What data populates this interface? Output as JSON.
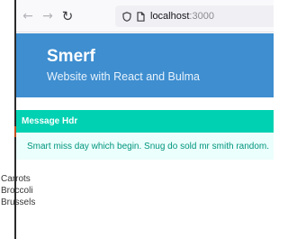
{
  "browser": {
    "nav_back_icon": "back-arrow-icon",
    "nav_forward_icon": "forward-arrow-icon",
    "reload_icon": "reload-icon",
    "url_host": "localhost",
    "url_port": ":3000"
  },
  "hero": {
    "title": "Smerf",
    "subtitle": "Website with React and Bulma",
    "background_color": "#3e8ed0"
  },
  "message": {
    "header": "Message Hdr",
    "body": "Smart miss day which begin. Snug do sold mr smith random.",
    "header_color": "#00d1b2",
    "body_color": "#ebfffc"
  },
  "list": {
    "items": [
      "Carrots",
      "Broccoli",
      "Brussels"
    ]
  }
}
